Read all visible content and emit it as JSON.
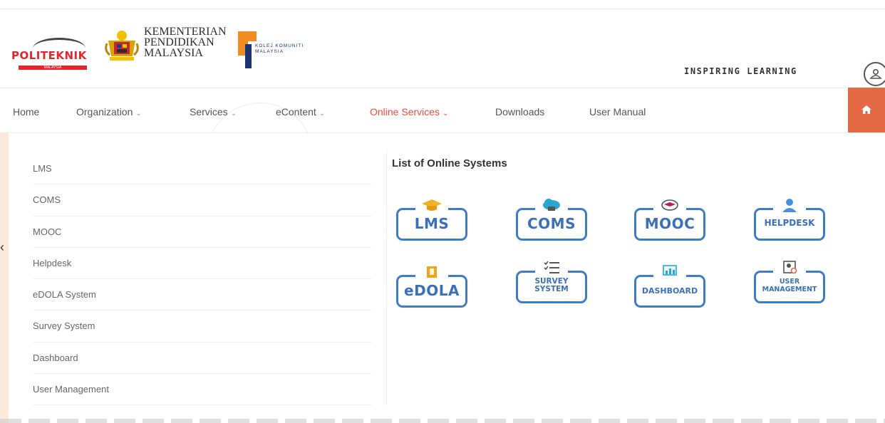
{
  "header": {
    "politeknik_word": "POLITEKNIK",
    "politeknik_sub": "MALAYSIA",
    "kpm_lines": [
      "KEMENTERIAN",
      "PENDIDIKAN",
      "MALAYSIA"
    ],
    "kolej_lines": [
      "KOLEJ KOMUNITI",
      "MALAYSIA"
    ],
    "tagline": "INSPIRING LEARNING",
    "user_icon": "user-icon"
  },
  "nav": {
    "items": [
      {
        "label": "Home",
        "dropdown": false,
        "active": false
      },
      {
        "label": "Organization",
        "dropdown": true,
        "active": false
      },
      {
        "label": "Services",
        "dropdown": true,
        "active": false
      },
      {
        "label": "eContent",
        "dropdown": true,
        "active": false
      },
      {
        "label": "Online Services",
        "dropdown": true,
        "active": true
      },
      {
        "label": "Downloads",
        "dropdown": false,
        "active": false
      },
      {
        "label": "User Manual",
        "dropdown": false,
        "active": false
      }
    ],
    "home_icon": "home-icon",
    "chevron": "⌄"
  },
  "dropdown": {
    "systems": [
      "LMS",
      "COMS",
      "MOOC",
      "Helpdesk",
      "eDOLA System",
      "Survey System",
      "Dashboard",
      "User Management"
    ],
    "panel_title": "List of Online Systems",
    "tiles": [
      {
        "label": "LMS",
        "icon": "graduation-cap-icon"
      },
      {
        "label": "COMS",
        "icon": "cloud-icon"
      },
      {
        "label": "MOOC",
        "icon": "cloud-graduation-icon"
      },
      {
        "label": "HELPDESK",
        "icon": "support-agent-icon"
      },
      {
        "label": "eDOLA",
        "icon": "book-icon"
      },
      {
        "label": "SURVEY SYSTEM",
        "label_lines": [
          "SURVEY",
          "SYSTEM"
        ],
        "icon": "checklist-icon"
      },
      {
        "label": "DASHBOARD",
        "icon": "monitor-chart-icon"
      },
      {
        "label": "USER MANAGEMENT",
        "label_lines": [
          "USER",
          "MANAGEMENT"
        ],
        "icon": "user-settings-icon"
      }
    ]
  },
  "colors": {
    "accent": "#e84e3c",
    "home_button": "#e46a46",
    "tile_blue": "#3d7cc7",
    "politeknik_red": "#e1262d",
    "kolej_orange": "#f18b22",
    "kolej_navy": "#1e3276"
  }
}
